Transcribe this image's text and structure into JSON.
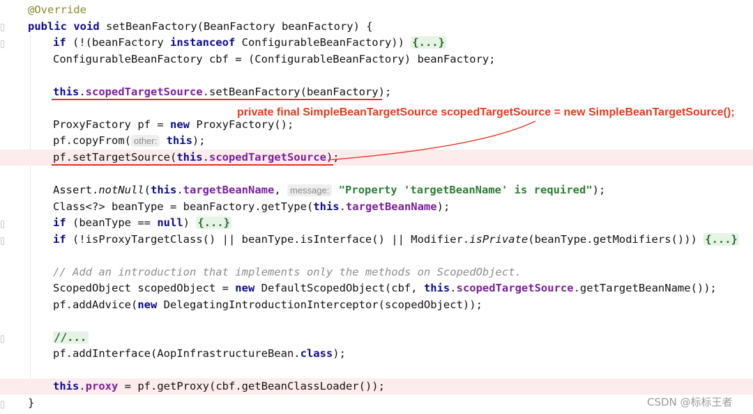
{
  "editor": {
    "lines": {
      "l1": {
        "a": "@Override"
      },
      "l2": {
        "a": "public",
        "b": " ",
        "c": "void",
        "d": " setBeanFactory(BeanFactory beanFactory) {"
      },
      "l3": {
        "a": "if",
        "b": " (!(beanFactory ",
        "c": "instanceof",
        "d": " ConfigurableBeanFactory)) ",
        "e": "{...}"
      },
      "l4": {
        "a": "ConfigurableBeanFactory cbf = (ConfigurableBeanFactory) beanFactory;"
      },
      "l5": {
        "a": "this",
        "b": ".",
        "c": "scopedTargetSource",
        "d": ".setBeanFactory(beanFactory);"
      },
      "l6": {
        "a": "ProxyFactory pf = ",
        "b": "new",
        "c": " ProxyFactory();"
      },
      "l7": {
        "a": "pf.copyFrom(",
        "hint": "other:",
        "b": " ",
        "c": "this",
        "d": ");"
      },
      "l8": {
        "a": "pf.setTargetSource(",
        "b": "this",
        "c": ".",
        "d": "scopedTargetSource",
        "e": ");"
      },
      "l9": {
        "a": "Assert.",
        "b": "notNull",
        "c": "(",
        "d": "this",
        "e": ".",
        "f": "targetBeanName",
        "g": ", ",
        "hint": "message:",
        "h": " ",
        "i": "\"Property 'targetBeanName' is required\"",
        "j": ");"
      },
      "l10": {
        "a": "Class<?> beanType = beanFactory.getType(",
        "b": "this",
        "c": ".",
        "d": "targetBeanName",
        "e": ");"
      },
      "l11": {
        "a": "if",
        "b": " (beanType == ",
        "c": "null",
        "d": ") ",
        "e": "{...}"
      },
      "l12": {
        "a": "if",
        "b": " (!isProxyTargetClass() || beanType.isInterface() || Modifier.",
        "c": "isPrivate",
        "d": "(beanType.getModifiers())) ",
        "e": "{...}"
      },
      "l13": {
        "a": "// Add an introduction that implements only the methods on ScopedObject."
      },
      "l14": {
        "a": "ScopedObject scopedObject = ",
        "b": "new",
        "c": " DefaultScopedObject(cbf, ",
        "d": "this",
        "e": ".",
        "f": "scopedTargetSource",
        "g": ".getTargetBeanName());"
      },
      "l15": {
        "a": "pf.addAdvice(",
        "b": "new",
        "c": " DelegatingIntroductionInterceptor(scopedObject));"
      },
      "l16": {
        "a": "//..."
      },
      "l17": {
        "a": "pf.addInterface(AopInfrastructureBean.",
        "b": "class",
        "c": ");"
      },
      "l18": {
        "a": "this",
        "b": ".",
        "c": "proxy",
        "d": " = pf.getProxy(cbf.getBeanClassLoader());"
      },
      "l19": {
        "a": "}"
      }
    }
  },
  "annotation": {
    "note": "private final SimpleBeanTargetSource scopedTargetSource = new SimpleBeanTargetSource();",
    "color": "#e63a1c"
  },
  "watermark": "CSDN @标标王者"
}
